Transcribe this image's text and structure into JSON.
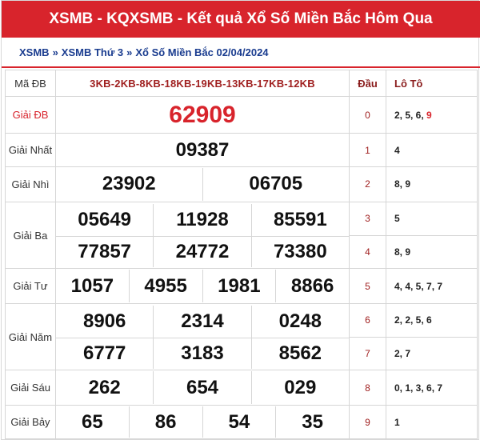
{
  "header": {
    "title": "XSMB - KQXSMB - Kết quả Xổ Số Miền Bắc Hôm Qua"
  },
  "breadcrumb": [
    "XSMB",
    "XSMB Thứ 3",
    "Xổ Số Miền Bắc 02/04/2024"
  ],
  "breadcrumb_sep": "»",
  "table": {
    "code_label": "Mã ĐB",
    "code_value": "3KB-2KB-8KB-18KB-19KB-13KB-17KB-12KB",
    "dau_header": "Đầu",
    "loto_header": "Lô Tô",
    "prizes": {
      "db": {
        "label": "Giải ĐB",
        "numbers": [
          "62909"
        ]
      },
      "nhat": {
        "label": "Giải Nhất",
        "numbers": [
          "09387"
        ]
      },
      "nhi": {
        "label": "Giải Nhì",
        "numbers": [
          "23902",
          "06705"
        ]
      },
      "ba": {
        "label": "Giải Ba",
        "rows": [
          [
            "05649",
            "11928",
            "85591"
          ],
          [
            "77857",
            "24772",
            "73380"
          ]
        ]
      },
      "tu": {
        "label": "Giải Tư",
        "numbers": [
          "1057",
          "4955",
          "1981",
          "8866"
        ]
      },
      "nam": {
        "label": "Giải Năm",
        "rows": [
          [
            "8906",
            "2314",
            "0248"
          ],
          [
            "6777",
            "3183",
            "8562"
          ]
        ]
      },
      "sau": {
        "label": "Giải Sáu",
        "numbers": [
          "262",
          "654",
          "029"
        ]
      },
      "bay": {
        "label": "Giải Bảy",
        "numbers": [
          "65",
          "86",
          "54",
          "35"
        ]
      }
    },
    "loto": [
      {
        "dau": "0",
        "lead": "2, 5, 6, ",
        "highlight": "9"
      },
      {
        "dau": "1",
        "lead": "4",
        "highlight": ""
      },
      {
        "dau": "2",
        "lead": "8, 9",
        "highlight": ""
      },
      {
        "dau": "3",
        "lead": "5",
        "highlight": ""
      },
      {
        "dau": "4",
        "lead": "8, 9",
        "highlight": ""
      },
      {
        "dau": "5",
        "lead": "4, 4, 5, 7, 7",
        "highlight": ""
      },
      {
        "dau": "6",
        "lead": "2, 2, 5, 6",
        "highlight": ""
      },
      {
        "dau": "7",
        "lead": "2, 7",
        "highlight": ""
      },
      {
        "dau": "8",
        "lead": "0, 1, 3, 6, 7",
        "highlight": ""
      },
      {
        "dau": "9",
        "lead": "1",
        "highlight": ""
      }
    ]
  },
  "colors": {
    "brand_red": "#d8242c",
    "link_blue": "#1a3c8f",
    "dark_red": "#a02020"
  }
}
